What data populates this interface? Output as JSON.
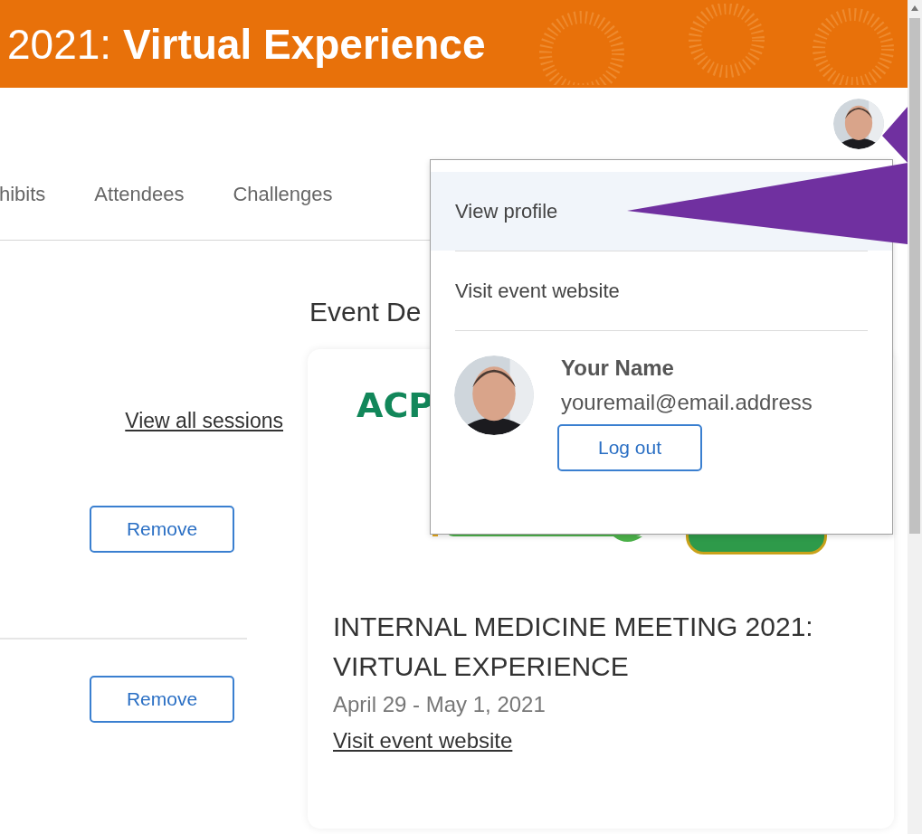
{
  "banner": {
    "title": "2021: **Virtual Experience**"
  },
  "nav": {
    "tabs": [
      {
        "label": "hibits",
        "selected": false
      },
      {
        "label": "Attendees",
        "selected": false
      },
      {
        "label": "Challenges",
        "selected": false
      }
    ]
  },
  "sessions": {
    "link": "View all sessions",
    "rows": [
      {
        "button": "Remove"
      },
      {
        "button": "Remove"
      }
    ]
  },
  "event": {
    "heading": "Event De",
    "logo": {
      "acronym": "ACP"
    },
    "title": "INTERNAL MEDICINE MEETING 2021: VIRTUAL EXPERIENCE",
    "dates": "April 29 - May 1, 2021",
    "link": "Visit event website"
  },
  "user_menu": {
    "items": [
      {
        "label": "View profile",
        "selected": true
      },
      {
        "label": "Visit event website",
        "selected": false
      }
    ],
    "name": "Your Name",
    "email": "youremail@email.address",
    "logout": "Log out"
  }
}
